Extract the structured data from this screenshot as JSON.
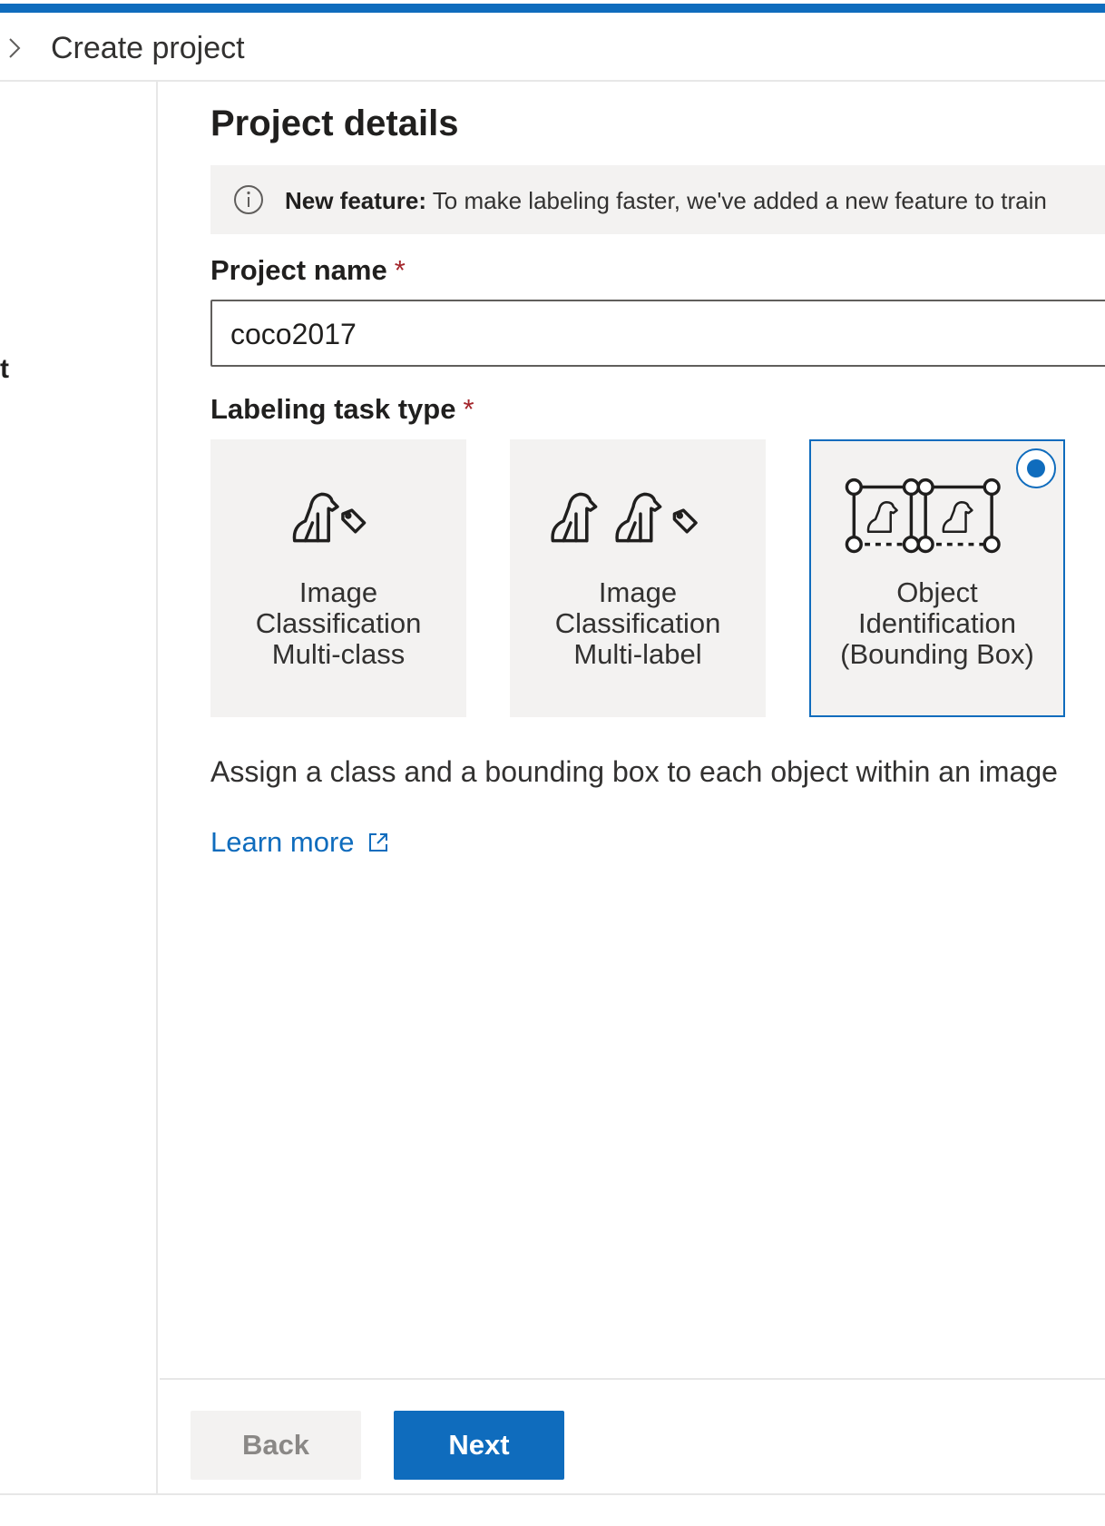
{
  "header": {
    "title": "Create project",
    "chevron_icon": "chevron-right-icon"
  },
  "left_rail": {
    "cut_text": "t"
  },
  "section": {
    "title": "Project details"
  },
  "info_bar": {
    "icon": "info-icon",
    "bold_label": "New feature:",
    "text": " To make labeling faster, we've added a new feature to train"
  },
  "project_name": {
    "label": "Project name",
    "required_mark": "*",
    "value": "coco2017"
  },
  "task_type": {
    "label": "Labeling task type",
    "required_mark": "*",
    "cards": [
      {
        "line1": "Image",
        "line2": "Classification",
        "line3": "Multi-class",
        "icon": "dog-tag-icon",
        "selected": false
      },
      {
        "line1": "Image",
        "line2": "Classification",
        "line3": "Multi-label",
        "icon": "two-dogs-tag-icon",
        "selected": false
      },
      {
        "line1": "Object",
        "line2": "Identification",
        "line3": "(Bounding Box)",
        "icon": "bounding-box-dogs-icon",
        "selected": true
      }
    ]
  },
  "description": "Assign a class and a bounding box to each object within an image",
  "learn_more": {
    "label": "Learn more",
    "icon": "external-link-icon"
  },
  "footer": {
    "back_label": "Back",
    "next_label": "Next"
  },
  "colors": {
    "accent": "#0f6cbd",
    "required": "#a4262c",
    "card_bg": "#f3f2f1"
  }
}
